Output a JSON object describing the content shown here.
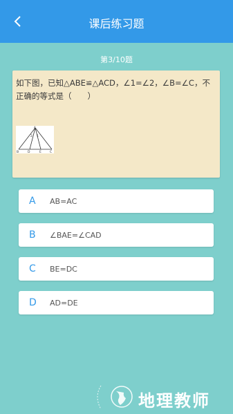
{
  "header": {
    "title": "课后练习题",
    "back_icon": "chevron-left-icon",
    "background": "#3399e8"
  },
  "progress": "第3/10题",
  "question": {
    "text": "如下图，已知△ABE≌△ACD，∠1=∠2，∠B=∠C，不正确的等式是（　　）",
    "figure_labels": {
      "apex": "A",
      "angle1": "2",
      "angle2": "1",
      "b": "B",
      "d": "D",
      "e": "E",
      "c": "C"
    }
  },
  "options": [
    {
      "letter": "A",
      "text": "AB=AC"
    },
    {
      "letter": "B",
      "text": "∠BAE=∠CAD"
    },
    {
      "letter": "C",
      "text": "BE=DC"
    },
    {
      "letter": "D",
      "text": "AD=DE"
    }
  ],
  "watermark": {
    "text": "地理教师"
  },
  "colors": {
    "background": "#7ecfcc",
    "card": "#f4e8c8",
    "accent": "#3399e8"
  }
}
